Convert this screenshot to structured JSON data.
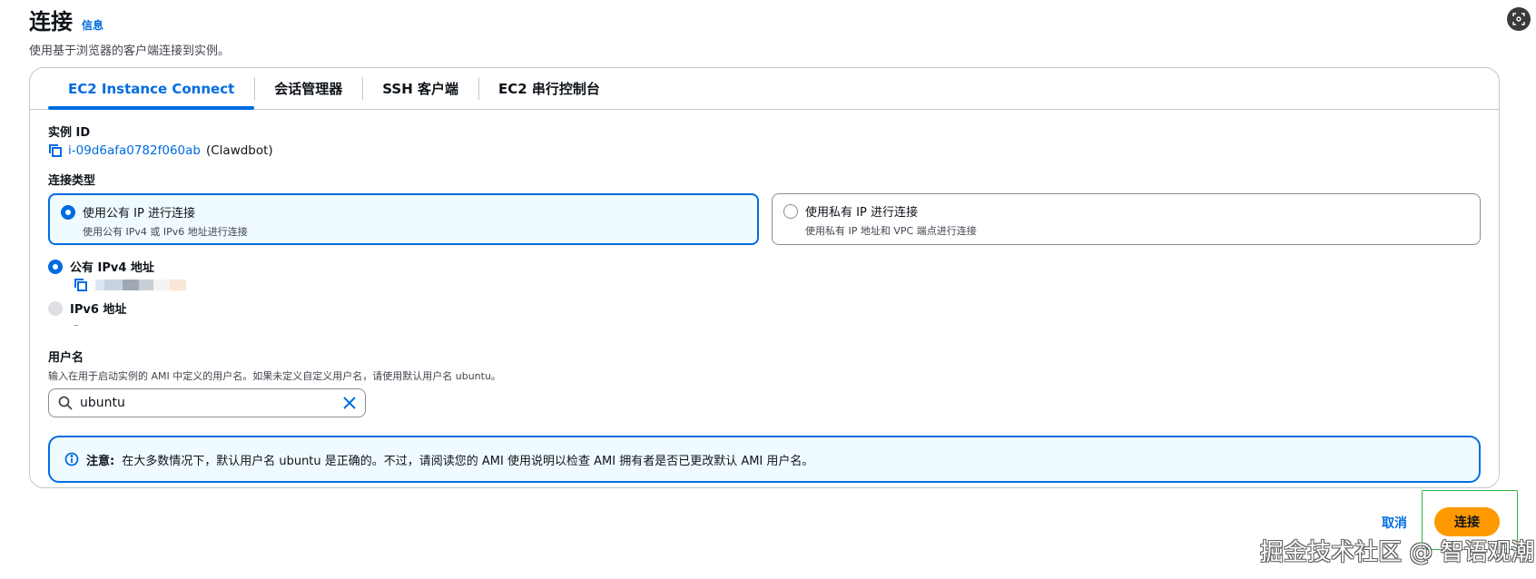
{
  "header": {
    "title": "连接",
    "info": "信息",
    "description": "使用基于浏览器的客户端连接到实例。"
  },
  "tabs": [
    {
      "label": "EC2 Instance Connect",
      "active": true
    },
    {
      "label": "会话管理器",
      "active": false
    },
    {
      "label": "SSH 客户端",
      "active": false
    },
    {
      "label": "EC2 串行控制台",
      "active": false
    }
  ],
  "instance": {
    "label": "实例 ID",
    "id": "i-09d6afa0782f060ab",
    "name": "(Clawdbot)"
  },
  "connection_type": {
    "label": "连接类型",
    "options": [
      {
        "title": "使用公有 IP 进行连接",
        "desc": "使用公有 IPv4 或 IPv6 地址进行连接",
        "selected": true
      },
      {
        "title": "使用私有 IP 进行连接",
        "desc": "使用私有 IP 地址和 VPC 端点进行连接",
        "selected": false
      }
    ]
  },
  "addresses": {
    "ipv4_label": "公有 IPv4 地址",
    "ipv6_label": "IPv6 地址",
    "ipv6_value": "–"
  },
  "username": {
    "label": "用户名",
    "description": "输入在用于启动实例的 AMI 中定义的用户名。如果未定义自定义用户名，请使用默认用户名 ubuntu。",
    "value": "ubuntu"
  },
  "alert": {
    "strong": "注意:",
    "text": "在大多数情况下，默认用户名 ubuntu 是正确的。不过，请阅读您的 AMI 使用说明以检查 AMI 拥有者是否已更改默认 AMI 用户名。"
  },
  "footer": {
    "cancel": "取消",
    "connect": "连接"
  },
  "watermark": "掘金技术社区 @ 智语观潮",
  "colors": {
    "primary": "#006ce0",
    "accent": "#ff9900",
    "highlight": "#2db34a"
  }
}
